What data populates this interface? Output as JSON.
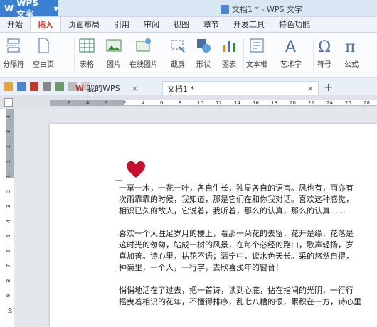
{
  "titlebar": {
    "app_name": "WPS 文字",
    "app_logo": "W",
    "doc_title": "文档1 * - WPS 文字"
  },
  "menu": {
    "tabs": [
      "开始",
      "插入",
      "页面布局",
      "引用",
      "审阅",
      "视图",
      "章节",
      "开发工具",
      "特色功能"
    ],
    "active": "插入"
  },
  "ribbon": {
    "buttons": [
      "分隔符",
      "空白页",
      "表格",
      "图片",
      "在线图片",
      "截屏",
      "形状",
      "图表",
      "文本框",
      "艺术字",
      "符号",
      "公式"
    ]
  },
  "doc_tabs": {
    "tab1": "我的WPS",
    "tab2": "文档1 *",
    "close": "×",
    "new": "+"
  },
  "ruler": {
    "h_ticks": [
      "6",
      "4",
      "2",
      "2",
      "4",
      "6",
      "8",
      "10",
      "12",
      "14",
      "16",
      "18",
      "20",
      "22",
      "24",
      "26",
      "28"
    ],
    "v_ticks": [
      "4",
      "3",
      "2",
      "1",
      "1",
      "2",
      "3",
      "4",
      "5",
      "6",
      "7",
      "8",
      "9",
      "10"
    ]
  },
  "document": {
    "paragraphs": [
      [
        "一草一木，一花一叶，各自生长，独显各自的语言。风也有，雨亦有",
        "次雨霏霏的时候，我知道，那是它们在和你我对话。喜欢这种感觉，",
        "相识已久的故人，它说着，我听着，那么的认真，那么的认真……"
      ],
      [
        "喜欢一个人驻足岁月的梗上，看那一朵花的去留，花开是缘，花落是",
        "这时光的匆匆，站成一树的风景，在每个必经的路口，歌声轻扬，岁",
        "真加善。诗心里，拈花不语；清宁中，读水色天长。采的悠然自得，",
        "种菊里，一个人，一行字，去欣喜浅年的窗台！"
      ],
      [
        "悄悄地活在了过去，把一首诗，读到心底，拈在指间的光阴，一行行",
        "摇曳着相识的花年，不懂得排序，乱七八糟的很，累积在一方，诗心里"
      ]
    ]
  },
  "colors": {
    "accent": "#3a7fd0",
    "active_tab": "#c0392b",
    "heart": "#c8102e"
  }
}
